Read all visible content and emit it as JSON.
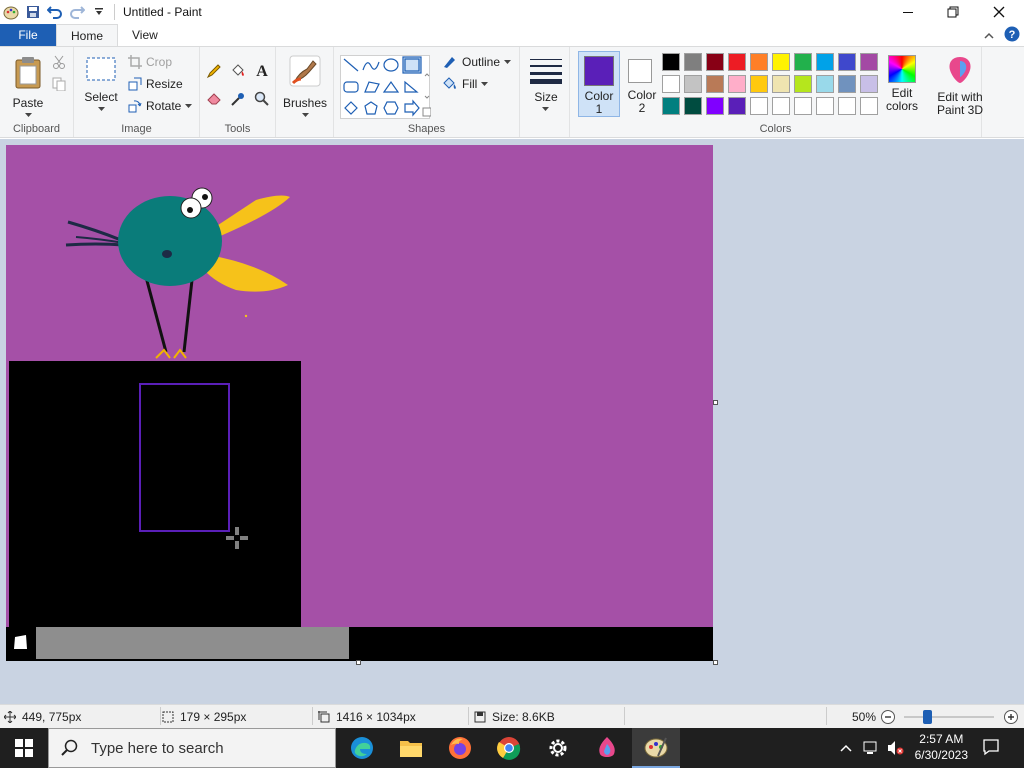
{
  "window": {
    "title": "Untitled - Paint"
  },
  "tabs": {
    "file": "File",
    "home": "Home",
    "view": "View"
  },
  "ribbon": {
    "clipboard": {
      "paste": "Paste",
      "label": "Clipboard"
    },
    "image": {
      "select": "Select",
      "crop": "Crop",
      "resize": "Resize",
      "rotate": "Rotate",
      "label": "Image"
    },
    "tools": {
      "label": "Tools"
    },
    "brushes": {
      "label": "Brushes"
    },
    "shapes": {
      "outline": "Outline",
      "fill": "Fill",
      "label": "Shapes"
    },
    "size": {
      "label": "Size"
    },
    "colors": {
      "color1": "Color 1",
      "color1_a": "Color",
      "color1_b": "1",
      "color2_a": "Color",
      "color2_b": "2",
      "edit_colors_a": "Edit",
      "edit_colors_b": "colors",
      "label": "Colors",
      "color1_value": "#5a1fb8",
      "color2_value": "#ffffff",
      "palette": [
        "#000000",
        "#7f7f7f",
        "#880015",
        "#ed1c24",
        "#ff7f27",
        "#fff200",
        "#22b14c",
        "#00a2e8",
        "#3f48cc",
        "#a349a4",
        "#ffffff",
        "#c3c3c3",
        "#b97a57",
        "#ffaec9",
        "#ffc90e",
        "#efe4b0",
        "#b5e61d",
        "#99d9ea",
        "#7092be",
        "#c8bfe7",
        "#007f7f",
        "#004c40",
        "#8000ff",
        "#5a1fb8",
        "#ffffff",
        "#ffffff",
        "#ffffff",
        "#ffffff",
        "#ffffff",
        "#ffffff"
      ]
    },
    "paint3d": {
      "a": "Edit with",
      "b": "Paint 3D"
    }
  },
  "status": {
    "cursor_pos": "449, 775px",
    "selection_size": "179 × 295px",
    "image_size": "1416 × 1034px",
    "file_size": "Size: 8.6KB",
    "zoom": "50%",
    "zoom_level": 0.5
  },
  "taskbar": {
    "search_placeholder": "Type here to search",
    "time": "2:57 AM",
    "date": "6/30/2023"
  }
}
